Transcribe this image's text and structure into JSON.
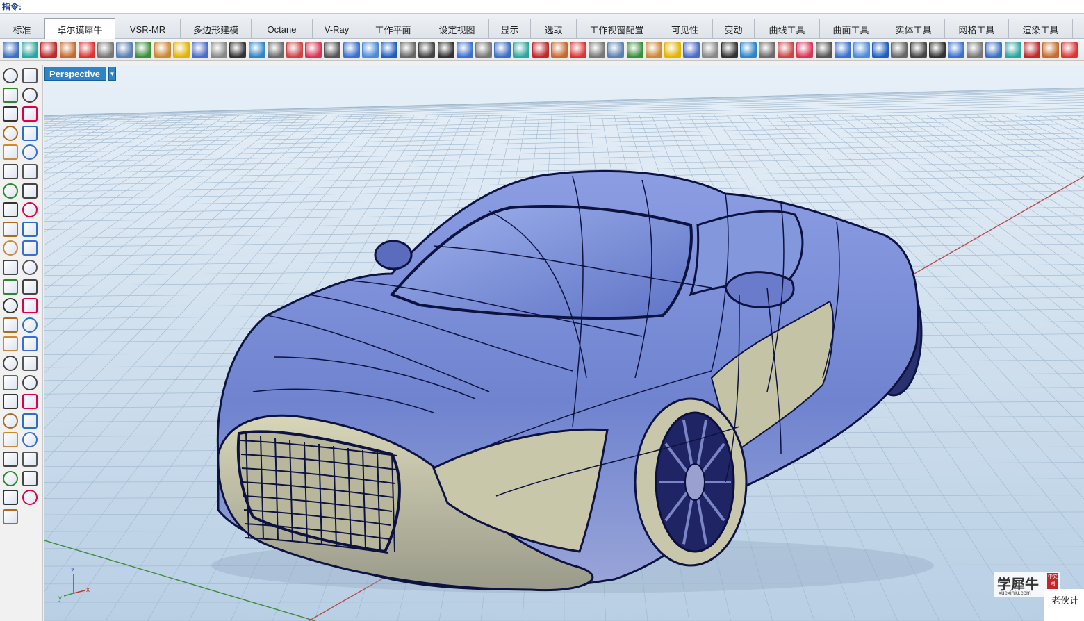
{
  "command": {
    "label": "指令:",
    "value": ""
  },
  "tabs": [
    {
      "label": "标准",
      "active": false
    },
    {
      "label": "卓尔谟犀牛",
      "active": true
    },
    {
      "label": "VSR-MR",
      "active": false
    },
    {
      "label": "多边形建模",
      "active": false
    },
    {
      "label": "Octane",
      "active": false
    },
    {
      "label": "V-Ray",
      "active": false
    },
    {
      "label": "工作平面",
      "active": false
    },
    {
      "label": "设定视图",
      "active": false
    },
    {
      "label": "显示",
      "active": false
    },
    {
      "label": "选取",
      "active": false
    },
    {
      "label": "工作视窗配置",
      "active": false
    },
    {
      "label": "可见性",
      "active": false
    },
    {
      "label": "变动",
      "active": false
    },
    {
      "label": "曲线工具",
      "active": false
    },
    {
      "label": "曲面工具",
      "active": false
    },
    {
      "label": "实体工具",
      "active": false
    },
    {
      "label": "网格工具",
      "active": false
    },
    {
      "label": "渲染工具",
      "active": false
    }
  ],
  "viewport": {
    "label": "Perspective",
    "dropdown_glyph": "▼"
  },
  "axis": {
    "x": "x",
    "y": "y",
    "z": "z"
  },
  "watermark": {
    "cn": "学犀牛",
    "en": "xuexiniu.com",
    "tag": "中文网"
  },
  "partner_label": "老伙计",
  "colors": {
    "viewport_label_bg": "#2d84c8",
    "car_body": "#7b8ed6",
    "car_lower": "#c8c6a6",
    "grid_line": "#9eb6cc",
    "x_axis": "#b84a48",
    "y_axis": "#3f8a3f"
  },
  "toolbar_icons": [
    "circle-arc-icon",
    "teal-sphere-icon",
    "red-box-icon",
    "sphere-texture-icon",
    "checker-icon",
    "color-bars-icon",
    "disk-icon",
    "landscape-icon",
    "red-cross-icon",
    "rainbow-icon",
    "plane-icon",
    "gear-icon",
    "checker-grid-icon",
    "transform-icon",
    "frame-icon",
    "target-icon",
    "diamond-icon",
    "rotate-icon",
    "scatter-icon",
    "cylinder-icon",
    "blue-diamond-icon",
    "points-icon",
    "grid-icon",
    "hexagon-icon",
    "cube-icon",
    "frame2-icon",
    "move-icon",
    "window-icon",
    "surface-icon",
    "nodes-icon",
    "boxes-icon",
    "network-icon",
    "slash-icon",
    "hand-icon",
    "move2-icon",
    "zigzag-icon",
    "c-shape-icon",
    "blue-surface-icon",
    "gem-icon",
    "ball-icon",
    "yellow-square-icon",
    "palette-icon",
    "spiral-icon",
    "ruler-icon",
    "cube-yellow-icon",
    "curve-icon",
    "arc-icon",
    "figure-icon",
    "blue-box-icon",
    "dots-icon",
    "swirl-icon",
    "badge-icon",
    "pin-icon",
    "frame3-icon",
    "frame4-icon",
    "frame5-icon",
    "frame6-icon"
  ],
  "side_icons": [
    "select-arrow-icon",
    "point-icon",
    "polyline-icon",
    "curve-points-icon",
    "circle-icon",
    "ellipse-icon",
    "polygon-icon",
    "rectangle-icon",
    "fillet-icon",
    "curve-fillet-icon",
    "surface-corner-icon",
    "extrude-icon",
    "box-icon",
    "sphere-icon",
    "cylinder-icon",
    "surface-edit-icon",
    "explode-icon",
    "trim-icon",
    "split-icon",
    "line-icon",
    "boolean-icon",
    "group-icon",
    "blend-icon",
    "arc-blend-icon",
    "text-icon",
    "dimension-icon",
    "array-icon",
    "history-icon",
    "solid-icon",
    "section-icon",
    "grid-array-icon",
    "transform-icon",
    "mirror-icon",
    "check-icon",
    "lens-icon",
    "pencil-icon",
    "magnet-icon",
    "light-icon",
    "join-icon",
    "tree-icon",
    "explode2-icon",
    "arrow-up-icon",
    "sphere-render-icon",
    "paper-icon",
    "link-icon",
    "fence-icon",
    "star-icon"
  ]
}
